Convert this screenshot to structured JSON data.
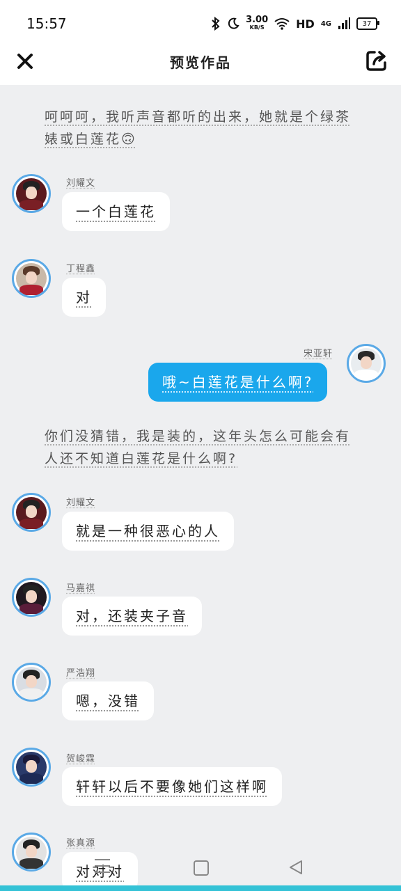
{
  "status_bar": {
    "time": "15:57",
    "net_speed_value": "3.00",
    "net_speed_unit": "KB/S",
    "hd_label": "HD",
    "signal_label": "4G",
    "battery_level": "37",
    "icons": [
      "bluetooth-icon",
      "moon-icon",
      "wifi-icon",
      "signal-icon",
      "battery-icon"
    ]
  },
  "app_bar": {
    "title": "预览作品",
    "close_icon": "close-icon",
    "share_icon": "share-icon"
  },
  "colors": {
    "accent": "#1aa7ec",
    "avatar_border": "#5aa9e6",
    "background": "#eeeff1",
    "bottom_bar": "#34c2d6"
  },
  "messages": [
    {
      "type": "narration",
      "text": "呵呵呵，我听声音都听的出来，她就是个绿茶婊或白莲花🙃"
    },
    {
      "type": "chat",
      "side": "left",
      "name": "刘耀文",
      "text": "一个白莲花"
    },
    {
      "type": "chat",
      "side": "left",
      "name": "丁程鑫",
      "text": "对"
    },
    {
      "type": "chat",
      "side": "right",
      "name": "宋亚轩",
      "text": "哦~白莲花是什么啊?"
    },
    {
      "type": "narration",
      "text": "你们没猜错，我是装的，这年头怎么可能会有人还不知道白莲花是什么啊?"
    },
    {
      "type": "chat",
      "side": "left",
      "name": "刘耀文",
      "text": "就是一种很恶心的人"
    },
    {
      "type": "chat",
      "side": "left",
      "name": "马嘉祺",
      "text": "对，还装夹子音"
    },
    {
      "type": "chat",
      "side": "left",
      "name": "严浩翔",
      "text": "嗯，没错"
    },
    {
      "type": "chat",
      "side": "left",
      "name": "贺峻霖",
      "text": "轩轩以后不要像她们这样啊"
    },
    {
      "type": "chat",
      "side": "left",
      "name": "张真源",
      "text": "对对对"
    }
  ],
  "nav_bar": {
    "icons": [
      "menu-icon",
      "home-icon",
      "back-icon"
    ]
  }
}
